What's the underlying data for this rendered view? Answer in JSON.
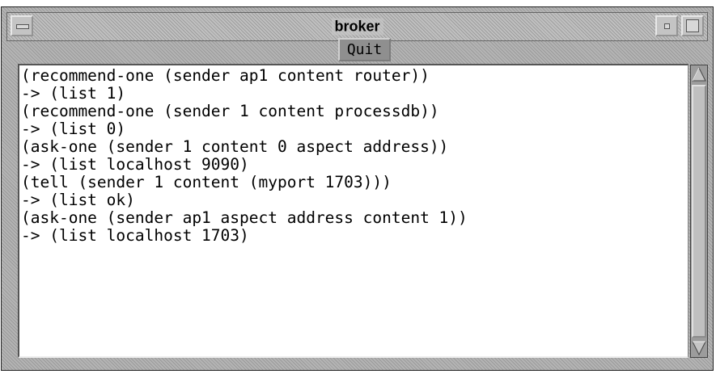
{
  "window": {
    "title": "broker"
  },
  "titlebar_icons": {
    "menu": "window-menu-icon",
    "minimize": "minimize-icon",
    "maximize": "maximize-icon"
  },
  "toolbar": {
    "quit_label": "Quit"
  },
  "output": {
    "lines": [
      "(recommend-one (sender ap1 content router))",
      "-> (list 1)",
      "(recommend-one (sender 1 content processdb))",
      "-> (list 0)",
      "(ask-one (sender 1 content 0 aspect address))",
      "-> (list localhost 9090)",
      "(tell (sender 1 content (myport 1703)))",
      "-> (list ok)",
      "(ask-one (sender ap1 aspect address content 1))",
      "-> (list localhost 1703)"
    ]
  },
  "scrollbar_icons": {
    "up": "scroll-up-arrow-icon",
    "down": "scroll-down-arrow-icon"
  }
}
